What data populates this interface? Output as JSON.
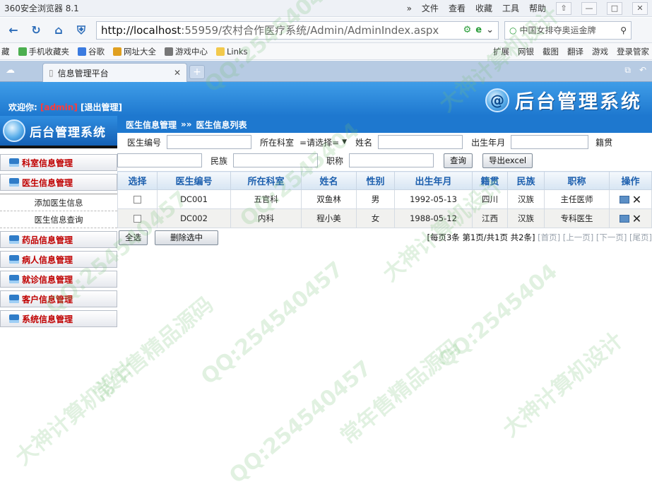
{
  "browser": {
    "app_title": "360安全浏览器 8.1",
    "menus": [
      "»",
      "文件",
      "查看",
      "收藏",
      "工具",
      "帮助"
    ],
    "url_host": "http://localhost",
    "url_rest": ":55959/农村合作医疗系统/Admin/AdminIndex.aspx",
    "search_text": "中国女排夺奥运金牌",
    "favorites": [
      "手机收藏夹",
      "谷歌",
      "网址大全",
      "游戏中心",
      "Links"
    ],
    "favorites_left_fragment": "藏",
    "toolbar_right": [
      "扩展",
      "网银",
      "截图",
      "翻译",
      "游戏",
      "登录管家"
    ],
    "tab_title": "信息管理平台"
  },
  "header": {
    "welcome": "欢迎你:",
    "username": "[admin]",
    "logout": "[退出管理]",
    "system_name": "后台管理系统",
    "badge": "@"
  },
  "sidebar": {
    "logo_text": "后台管理系统",
    "items_top": [
      "科室信息管理",
      "医生信息管理"
    ],
    "sub_items": [
      "添加医生信息",
      "医生信息查询"
    ],
    "items_bottom": [
      "药品信息管理",
      "病人信息管理",
      "就诊信息管理",
      "客户信息管理",
      "系统信息管理"
    ]
  },
  "breadcrumb": {
    "parent": "医生信息管理",
    "sep": "»»",
    "current": "医生信息列表"
  },
  "filters": {
    "doctor_no_label": "医生编号",
    "dept_label": "所在科室",
    "dept_selected": "=请选择=",
    "name_label": "姓名",
    "birth_label": "出生年月",
    "native_label": "籍贯",
    "ethnicity_label": "民族",
    "title_label": "职称",
    "query_button": "查询",
    "export_button": "导出excel"
  },
  "table": {
    "headers": [
      "选择",
      "医生编号",
      "所在科室",
      "姓名",
      "性别",
      "出生年月",
      "籍贯",
      "民族",
      "职称",
      "操作"
    ],
    "rows": [
      {
        "no": "DC001",
        "dept": "五官科",
        "name": "双鱼林",
        "gender": "男",
        "birth": "1992-05-13",
        "native": "四川",
        "ethnicity": "汉族",
        "title": "主任医师"
      },
      {
        "no": "DC002",
        "dept": "内科",
        "name": "程小美",
        "gender": "女",
        "birth": "1988-05-12",
        "native": "江西",
        "ethnicity": "汉族",
        "title": "专科医生"
      }
    ]
  },
  "pager": {
    "select_all": "全选",
    "delete_selected": "删除选中",
    "summary": "[每页3条 第1页/共1页 共2条]",
    "first": "[首页]",
    "prev": "[上一页]",
    "next": "[下一页]",
    "last": "[尾页]"
  },
  "watermark": {
    "qq": "QQ:2545404",
    "qq_full": "QQ:254540457",
    "slogan1": "常年售精品源码",
    "slogan2": "大神计算机设计"
  }
}
